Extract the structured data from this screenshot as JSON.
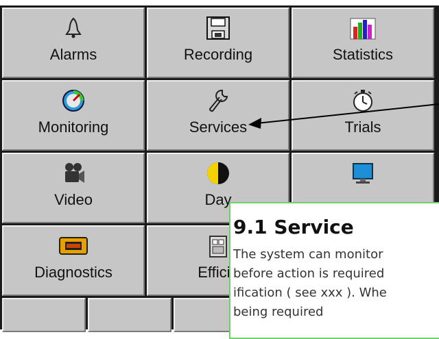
{
  "menu": {
    "row1": [
      {
        "label": "Alarms",
        "icon": "bell-icon"
      },
      {
        "label": "Recording",
        "icon": "floppy-disk-icon"
      },
      {
        "label": "Statistics",
        "icon": "bar-chart-icon"
      }
    ],
    "row2": [
      {
        "label": "Monitoring",
        "icon": "gauge-icon"
      },
      {
        "label": "Services",
        "icon": "wrench-icon"
      },
      {
        "label": "Trials",
        "icon": "stopwatch-icon"
      }
    ],
    "row3": [
      {
        "label": "Video",
        "icon": "video-camera-icon"
      },
      {
        "label": "Day",
        "icon": "day-night-icon"
      },
      {
        "label": "",
        "icon": "monitor-icon"
      }
    ],
    "row4": [
      {
        "label": "Diagnostics",
        "icon": "check-engine-icon"
      },
      {
        "label": "Efficie",
        "icon": "efficiency-icon"
      }
    ]
  },
  "doc": {
    "heading": "9.1 Service",
    "line1": "The system can monitor",
    "line2": "before action is required",
    "line3": "ification ( see xxx ). Whe",
    "line4": "being required"
  },
  "colors": {
    "tile": "#c6c6c6",
    "border": "#6fcf6f"
  }
}
